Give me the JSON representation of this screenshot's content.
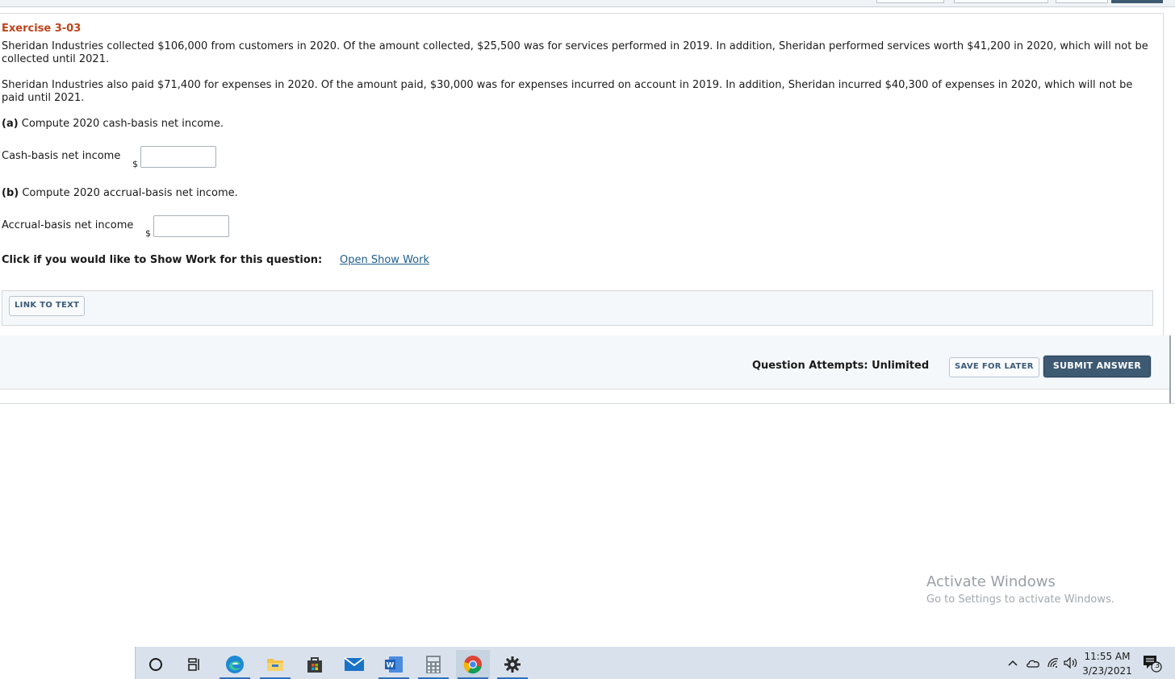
{
  "exercise": {
    "title": "Exercise 3-03",
    "para1": "Sheridan Industries collected $106,000 from customers in 2020. Of the amount collected, $25,500 was for services performed in 2019. In addition, Sheridan performed services worth $41,200  in 2020, which will not be collected until 2021.",
    "para2": "Sheridan Industries also paid $71,400 for expenses in 2020. Of the amount paid, $30,000 was for expenses incurred on account in 2019. In addition, Sheridan incurred $40,300 of expenses in 2020, which will not be paid until 2021.",
    "part_a": {
      "tag": "(a)",
      "text": "Compute 2020 cash-basis net income.",
      "field_label": "Cash-basis net income",
      "currency": "$",
      "value": ""
    },
    "part_b": {
      "tag": "(b)",
      "text": "Compute 2020 accrual-basis net income.",
      "field_label": "Accrual-basis net income",
      "currency": "$",
      "value": ""
    },
    "show_work_label": "Click if you would like to Show Work for this question:",
    "show_work_link": "Open Show Work",
    "link_to_text": "LINK TO TEXT"
  },
  "footer": {
    "attempts": "Question Attempts: Unlimited",
    "save_label": "SAVE FOR LATER",
    "submit_label": "SUBMIT ANSWER"
  },
  "watermark": {
    "line1": "Activate Windows",
    "line2": "Go to Settings to activate Windows."
  },
  "taskbar": {
    "apps": [
      "search-circle-icon",
      "task-view-icon",
      "edge-icon",
      "file-explorer-icon",
      "store-icon",
      "mail-icon",
      "word-icon",
      "calculator-icon",
      "chrome-icon",
      "settings-icon"
    ],
    "time": "11:55 AM",
    "date": "3/23/2021",
    "notifications": "3"
  },
  "colors": {
    "title": "#c0431a",
    "link": "#1f5e8e",
    "submit_bg": "#3e5a73",
    "taskbar": "#d9e2ec"
  }
}
